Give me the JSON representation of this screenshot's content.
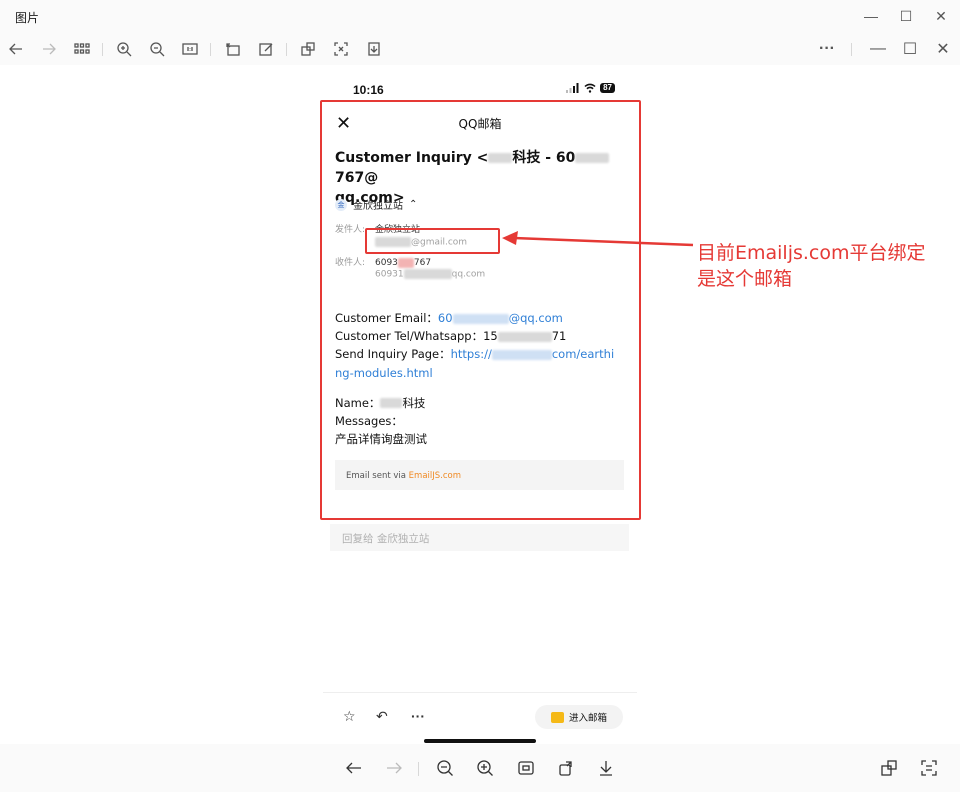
{
  "window": {
    "title": "图片"
  },
  "phone": {
    "status_time": "10:16",
    "battery": "87",
    "header_title": "QQ邮箱",
    "subject_line1": "Customer Inquiry <",
    "subject_line1_mid": "科技 - 60",
    "subject_line1_end": "767@",
    "subject_line2": "qq.com>",
    "sender_chip": "金欣独立站",
    "sender_avatar": "金",
    "from_label": "发件人:",
    "from_name": "金欣独立站",
    "from_email_suffix": "@gmail.com",
    "to_label": "收件人:",
    "to_name_start": "6093",
    "to_name_end": "767",
    "to_email_start": "60931",
    "to_email_end": "qq.com",
    "email_label": "Customer Email：",
    "email_value_start": "60",
    "email_value_end": "@qq.com",
    "tel_label": "Customer Tel/Whatsapp：",
    "tel_start": "15",
    "tel_end": "71",
    "page_label": "Send Inquiry Page：",
    "page_link_start": "https://",
    "page_link_end": "com/earthi",
    "page_link_line2": "ng-modules.html",
    "name_label": "Name：",
    "name_value_end": "科技",
    "messages_label": "Messages：",
    "messages_value": "产品详情询盘测试",
    "sent_via_prefix": "Email sent via ",
    "sent_via_link": "EmailJS.com",
    "reply_placeholder": "回复给 金欣独立站",
    "enter_mail": "进入邮箱"
  },
  "annotation": {
    "line1": "目前Emailjs.com平台绑定",
    "line2": "是这个邮箱",
    "color": "#e53935"
  },
  "icons": {
    "toolbar": [
      "back-icon",
      "forward-icon",
      "grid-icon",
      "zoom-in-icon",
      "zoom-out-icon",
      "actual-size-icon",
      "rotate-icon",
      "edit-icon",
      "translate-icon",
      "ocr-icon",
      "save-icon",
      "more-icon",
      "minimize-icon",
      "maximize-icon",
      "close-icon"
    ]
  }
}
